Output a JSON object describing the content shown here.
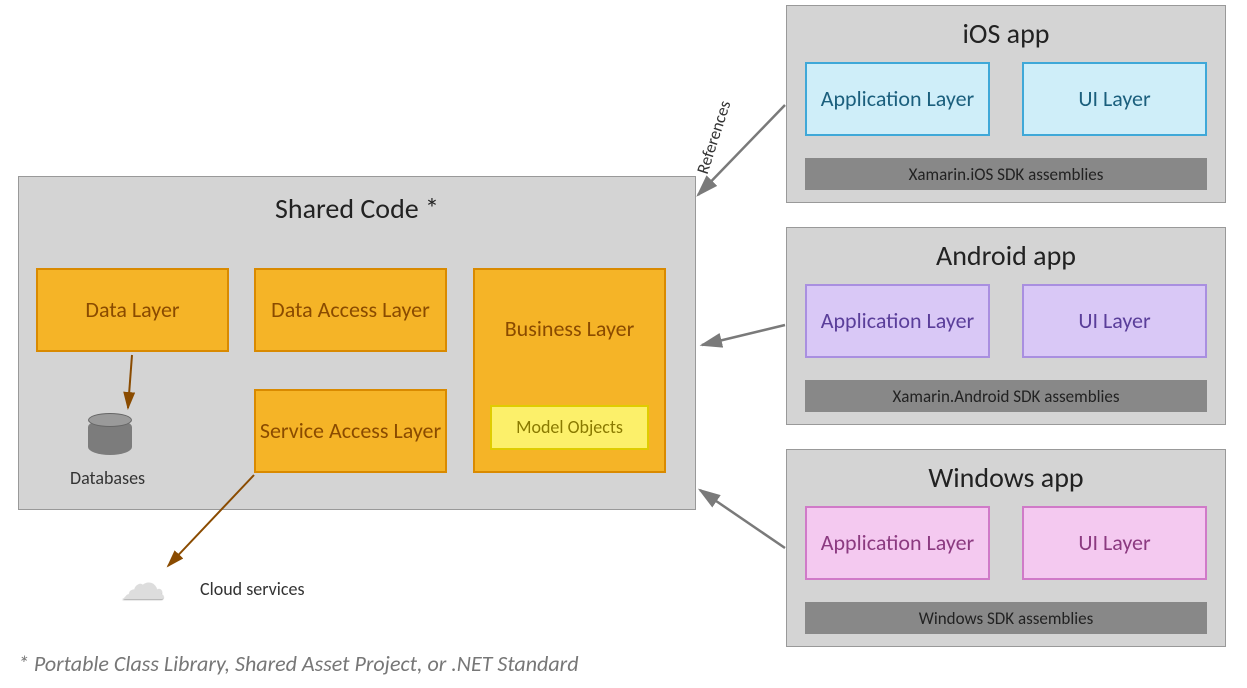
{
  "shared": {
    "title": "Shared Code *",
    "data_layer": "Data Layer",
    "data_access": "Data Access Layer",
    "service_access": "Service Access Layer",
    "business": "Business Layer",
    "model_objects": "Model Objects",
    "databases": "Databases",
    "cloud_services": "Cloud services"
  },
  "apps": {
    "ios": {
      "title": "iOS app",
      "app_layer": "Application Layer",
      "ui_layer": "UI Layer",
      "sdk": "Xamarin.iOS SDK assemblies"
    },
    "android": {
      "title": "Android app",
      "app_layer": "Application Layer",
      "ui_layer": "UI Layer",
      "sdk": "Xamarin.Android SDK assemblies"
    },
    "windows": {
      "title": "Windows app",
      "app_layer": "Application Layer",
      "ui_layer": "UI Layer",
      "sdk": "Windows SDK assemblies"
    }
  },
  "labels": {
    "references": "References"
  },
  "footnote": "* Portable Class Library, Shared Asset Project, or .NET Standard"
}
